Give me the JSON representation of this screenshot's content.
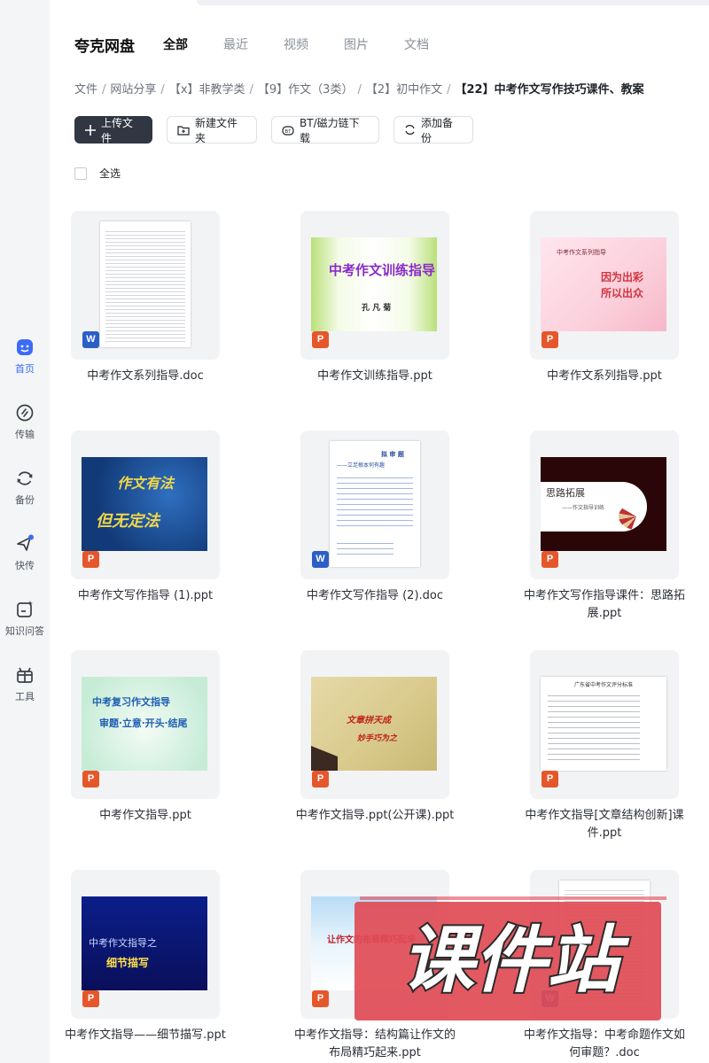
{
  "app": {
    "title": "夸克网盘"
  },
  "sidebar": {
    "items": [
      {
        "label": "首页",
        "icon": "home-icon",
        "active": true
      },
      {
        "label": "传输",
        "icon": "transfer-icon"
      },
      {
        "label": "备份",
        "icon": "backup-icon"
      },
      {
        "label": "快传",
        "icon": "quick-send-icon"
      },
      {
        "label": "知识问答",
        "icon": "qa-icon"
      },
      {
        "label": "工具",
        "icon": "tools-icon"
      }
    ]
  },
  "header": {
    "tabs": [
      {
        "label": "全部",
        "active": true
      },
      {
        "label": "最近"
      },
      {
        "label": "视频"
      },
      {
        "label": "图片"
      },
      {
        "label": "文档"
      }
    ]
  },
  "breadcrumb": {
    "items": [
      "文件",
      "网站分享",
      "【x】非教学类",
      "【9】作文（3类）",
      "【2】初中作文",
      "【22】中考作文写作技巧课件、教案"
    ]
  },
  "toolbar": {
    "upload_label": "上传文件",
    "new_folder_label": "新建文件夹",
    "bt_label": "BT/磁力链下载",
    "backup_label": "添加备份"
  },
  "select_all_label": "全选",
  "files": [
    {
      "name": "中考作文系列指导.doc",
      "type": "W"
    },
    {
      "name": "中考作文训练指导.ppt",
      "type": "P",
      "slide_title": "中考作文训练指导",
      "slide_sub": "孔 凡 菊"
    },
    {
      "name": "中考作文系列指导.ppt",
      "type": "P",
      "slide_title": "中考作文系列指导",
      "slide_sub": "因为出彩\n所以出众"
    },
    {
      "name": "中考作文写作指导 (1).ppt",
      "type": "P",
      "slide_title": "作文有法",
      "slide_sub": "但无定法"
    },
    {
      "name": "中考作文写作指导 (2).doc",
      "type": "W",
      "slide_title": "拟 审 题",
      "slide_sub": "——立足根本何有趣"
    },
    {
      "name": "中考作文写作指导课件：思路拓展.ppt",
      "type": "P",
      "slide_title": "思路拓展",
      "slide_sub": "——作文指导训练"
    },
    {
      "name": "中考作文指导.ppt",
      "type": "P",
      "slide_title": "中考复习作文指导",
      "slide_sub": "审题·立意·开头·结尾"
    },
    {
      "name": "中考作文指导.ppt(公开课).ppt",
      "type": "P",
      "slide_title": "文章拼天成",
      "slide_sub": "妙手巧为之"
    },
    {
      "name": "中考作文指导[文章结构创新]课件.ppt",
      "type": "P",
      "slide_title": "广东省中考作文评分标准"
    },
    {
      "name": "中考作文指导——细节描写.ppt",
      "type": "P",
      "slide_title": "中考作文指导之",
      "slide_sub": "细节描写"
    },
    {
      "name": "中考作文指导：结构篇让作文的布局精巧起来.ppt",
      "type": "P",
      "slide_title": "让作文的布局精巧起来"
    },
    {
      "name": "中考作文指导：中考命题作文如何审题？.doc",
      "type": "W"
    }
  ],
  "watermark": {
    "text": "课件站"
  },
  "colors": {
    "accent": "#3b6cf6",
    "primary_button": "#303742",
    "word_badge": "#2b5fc6",
    "ppt_badge": "#e5572b",
    "watermark": "#e04b55"
  }
}
